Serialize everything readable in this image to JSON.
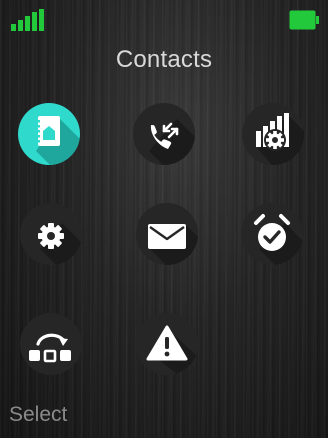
{
  "status_bar": {
    "signal_icon": "signal-bars-icon",
    "signal_bars": 5,
    "battery_icon": "battery-full-icon",
    "battery_level": 1.0,
    "accent_color": "#22c93a"
  },
  "header": {
    "title": "Contacts"
  },
  "menu": {
    "selected_color": "#2fd9cc",
    "items": [
      {
        "id": "contacts",
        "icon": "contacts-book-icon",
        "selected": true
      },
      {
        "id": "calls",
        "icon": "call-history-icon",
        "selected": false
      },
      {
        "id": "status",
        "icon": "status-settings-icon",
        "selected": false
      },
      {
        "id": "settings",
        "icon": "gear-icon",
        "selected": false
      },
      {
        "id": "messages",
        "icon": "envelope-icon",
        "selected": false
      },
      {
        "id": "alarm",
        "icon": "alarm-clock-icon",
        "selected": false
      },
      {
        "id": "transfer",
        "icon": "data-transfer-icon",
        "selected": false
      },
      {
        "id": "alert",
        "icon": "warning-icon",
        "selected": false
      }
    ]
  },
  "softkeys": {
    "left": "Select"
  }
}
